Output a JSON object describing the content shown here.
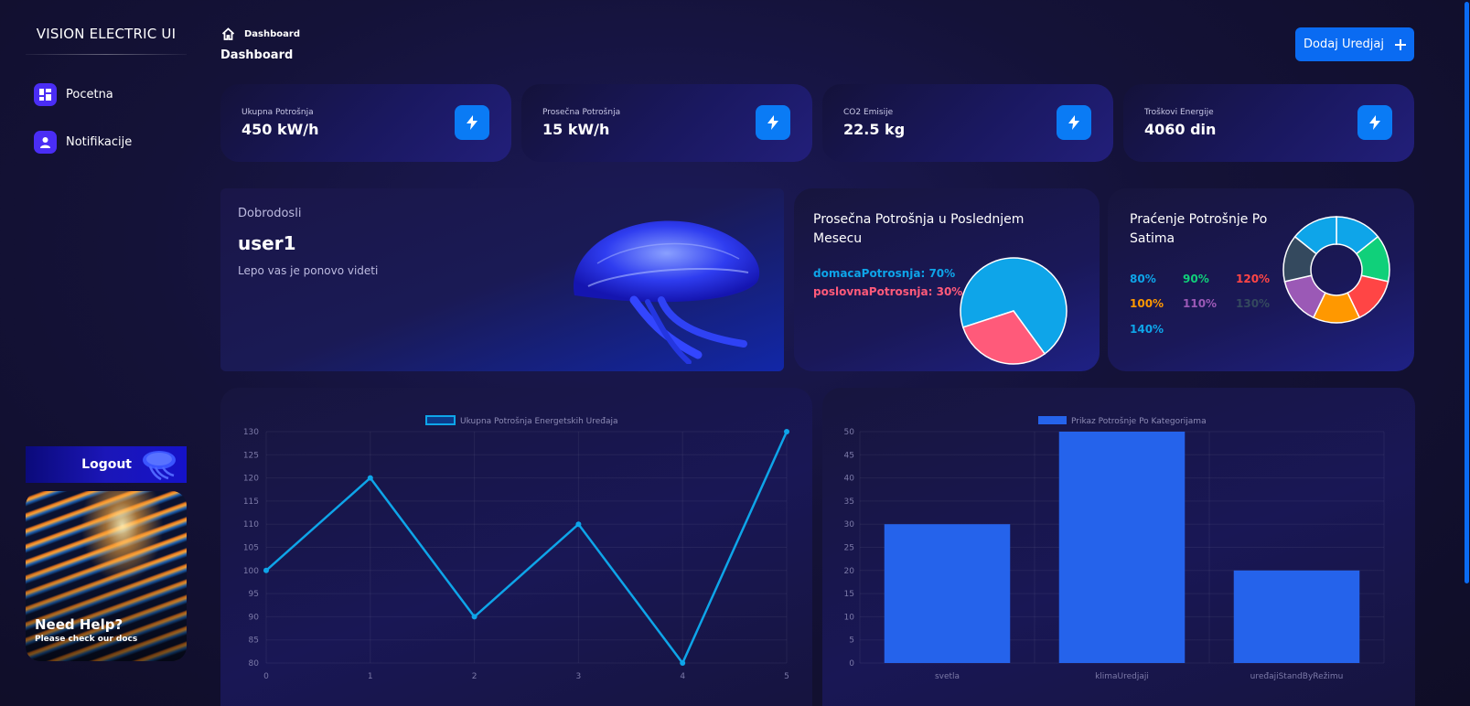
{
  "sidebar": {
    "brand": "VISION ELECTRIC UI",
    "items": [
      {
        "label": "Pocetna",
        "icon": "dashboard-icon"
      },
      {
        "label": "Notifikacije",
        "icon": "user-icon"
      }
    ],
    "logout_label": "Logout",
    "help": {
      "title": "Need Help?",
      "subtitle": "Please check our docs"
    }
  },
  "header": {
    "breadcrumb": "Dashboard",
    "title": "Dashboard",
    "add_button": "Dodaj Uredjaj"
  },
  "stats": [
    {
      "label": "Ukupna Potrošnja",
      "value": "450 kW/h"
    },
    {
      "label": "Prosečna Potrošnja",
      "value": "15 kW/h"
    },
    {
      "label": "CO2 Emisije",
      "value": "22.5 kg"
    },
    {
      "label": "Troškovi Energije",
      "value": "4060 din"
    }
  ],
  "welcome": {
    "greeting": "Dobrodosli",
    "user": "user1",
    "message": "Lepo vas je ponovo videti"
  },
  "avg_pie": {
    "title": "Prosečna Potrošnja u Poslednjem Mesecu",
    "legend": [
      {
        "text": "domacaPotrosnja: 70%",
        "color": "#0ea5e9"
      },
      {
        "text": "poslovnaPotrosnja: 30%",
        "color": "#ff5a7a"
      }
    ]
  },
  "hours_pie": {
    "title": "Praćenje Potrošnje Po Satima",
    "legend": [
      {
        "text": "80%",
        "color": "#0ea5e9"
      },
      {
        "text": "90%",
        "color": "#10d07a"
      },
      {
        "text": "120%",
        "color": "#ff4545"
      },
      {
        "text": "100%",
        "color": "#ff9800"
      },
      {
        "text": "110%",
        "color": "#9b59b6"
      },
      {
        "text": "130%",
        "color": "#34495e"
      },
      {
        "text": "140%",
        "color": "#0ea5e9"
      }
    ]
  },
  "colors": {
    "accent": "#0a6bf2",
    "line": "#0ea5e9",
    "bar": "#2563eb"
  },
  "chart_data": [
    {
      "type": "pie",
      "title": "Prosečna Potrošnja u Poslednjem Mesecu",
      "categories": [
        "domacaPotrosnja",
        "poslovnaPotrosnja"
      ],
      "values": [
        70,
        30
      ],
      "colors": [
        "#0ea5e9",
        "#ff5a7a"
      ]
    },
    {
      "type": "pie",
      "title": "Praćenje Potrošnje Po Satima",
      "categories": [
        "80%",
        "90%",
        "120%",
        "100%",
        "110%",
        "130%",
        "140%"
      ],
      "values": [
        1,
        1,
        1,
        1,
        1,
        1,
        1
      ],
      "colors": [
        "#0ea5e9",
        "#10d07a",
        "#ff4545",
        "#ff9800",
        "#9b59b6",
        "#34495e",
        "#0ea5e9"
      ]
    },
    {
      "type": "line",
      "series": [
        {
          "name": "Ukupna Potrošnja Energetskih Uređaja",
          "values": [
            100,
            120,
            90,
            110,
            80,
            130
          ]
        }
      ],
      "x": [
        0,
        1,
        2,
        3,
        4,
        5
      ],
      "ylim": [
        80,
        130
      ],
      "yticks": [
        80,
        85,
        90,
        95,
        100,
        105,
        110,
        115,
        120,
        125,
        130
      ],
      "grid": true,
      "legend": "top-center"
    },
    {
      "type": "bar",
      "series": [
        {
          "name": "Prikaz Potrošnje Po Kategorijama",
          "values": [
            30,
            50,
            20
          ]
        }
      ],
      "categories": [
        "svetla",
        "klimaUredjaji",
        "uređajiStandByRežimu"
      ],
      "ylim": [
        0,
        50
      ],
      "yticks": [
        0,
        5,
        10,
        15,
        20,
        25,
        30,
        35,
        40,
        45,
        50
      ],
      "grid": true,
      "legend": "top-center"
    }
  ]
}
